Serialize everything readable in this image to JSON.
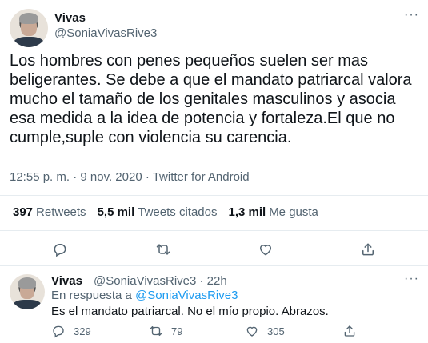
{
  "tweet": {
    "author_name": "Vivas",
    "author_handle": "@SoniaVivasRive3",
    "more_icon": "more-icon",
    "text": "Los hombres con penes pequeños suelen ser mas beligerantes. Se debe a que el mandato patriarcal valora mucho el tamaño de los genitales masculinos y asocia esa medida a la idea de potencia y fortaleza.El que no cumple,suple con violencia su carencia.",
    "meta": "12:55 p. m. · 9 nov. 2020 · Twitter for Android",
    "stats": {
      "retweets_count": "397",
      "retweets_label": "Retweets",
      "quotes_count": "5,5 mil",
      "quotes_label": "Tweets citados",
      "likes_count": "1,3 mil",
      "likes_label": "Me gusta"
    }
  },
  "reply": {
    "author_name": "Vivas",
    "author_handle": "@SoniaVivasRive3 · 22h",
    "replying_prefix": "En respuesta a",
    "replying_to": "@SoniaVivasRive3",
    "text": "Es el mandato patriarcal. No el mío propio. Abrazos.",
    "counts": {
      "replies": "329",
      "retweets": "79",
      "likes": "305"
    }
  },
  "colors": {
    "text": "#0f1419",
    "secondary": "#536471",
    "link": "#1d9bf0",
    "divider": "#e6ecf0"
  }
}
